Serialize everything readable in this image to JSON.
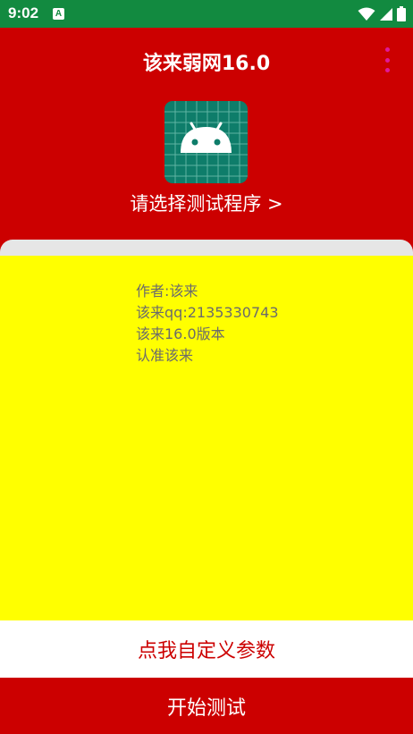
{
  "status_bar": {
    "time": "9:02",
    "notification_icon": "A",
    "icons": [
      "wifi-icon",
      "signal-icon",
      "battery-icon"
    ]
  },
  "toolbar": {
    "title": "该来弱网16.0",
    "overflow_icon": "more-vert-icon"
  },
  "header": {
    "app_icon": "android-icon",
    "select_program_label": "请选择测试程序 >"
  },
  "info": {
    "lines": [
      "作者:该来",
      "该来qq:2135330743",
      "该来16.0版本",
      "认准该来"
    ]
  },
  "buttons": {
    "custom_params": "点我自定义参数",
    "start_test": "开始测试"
  },
  "colors": {
    "status_bar": "#128A40",
    "primary": "#CC0000",
    "content_bg": "#FFFF00",
    "accent": "#E0199A"
  }
}
